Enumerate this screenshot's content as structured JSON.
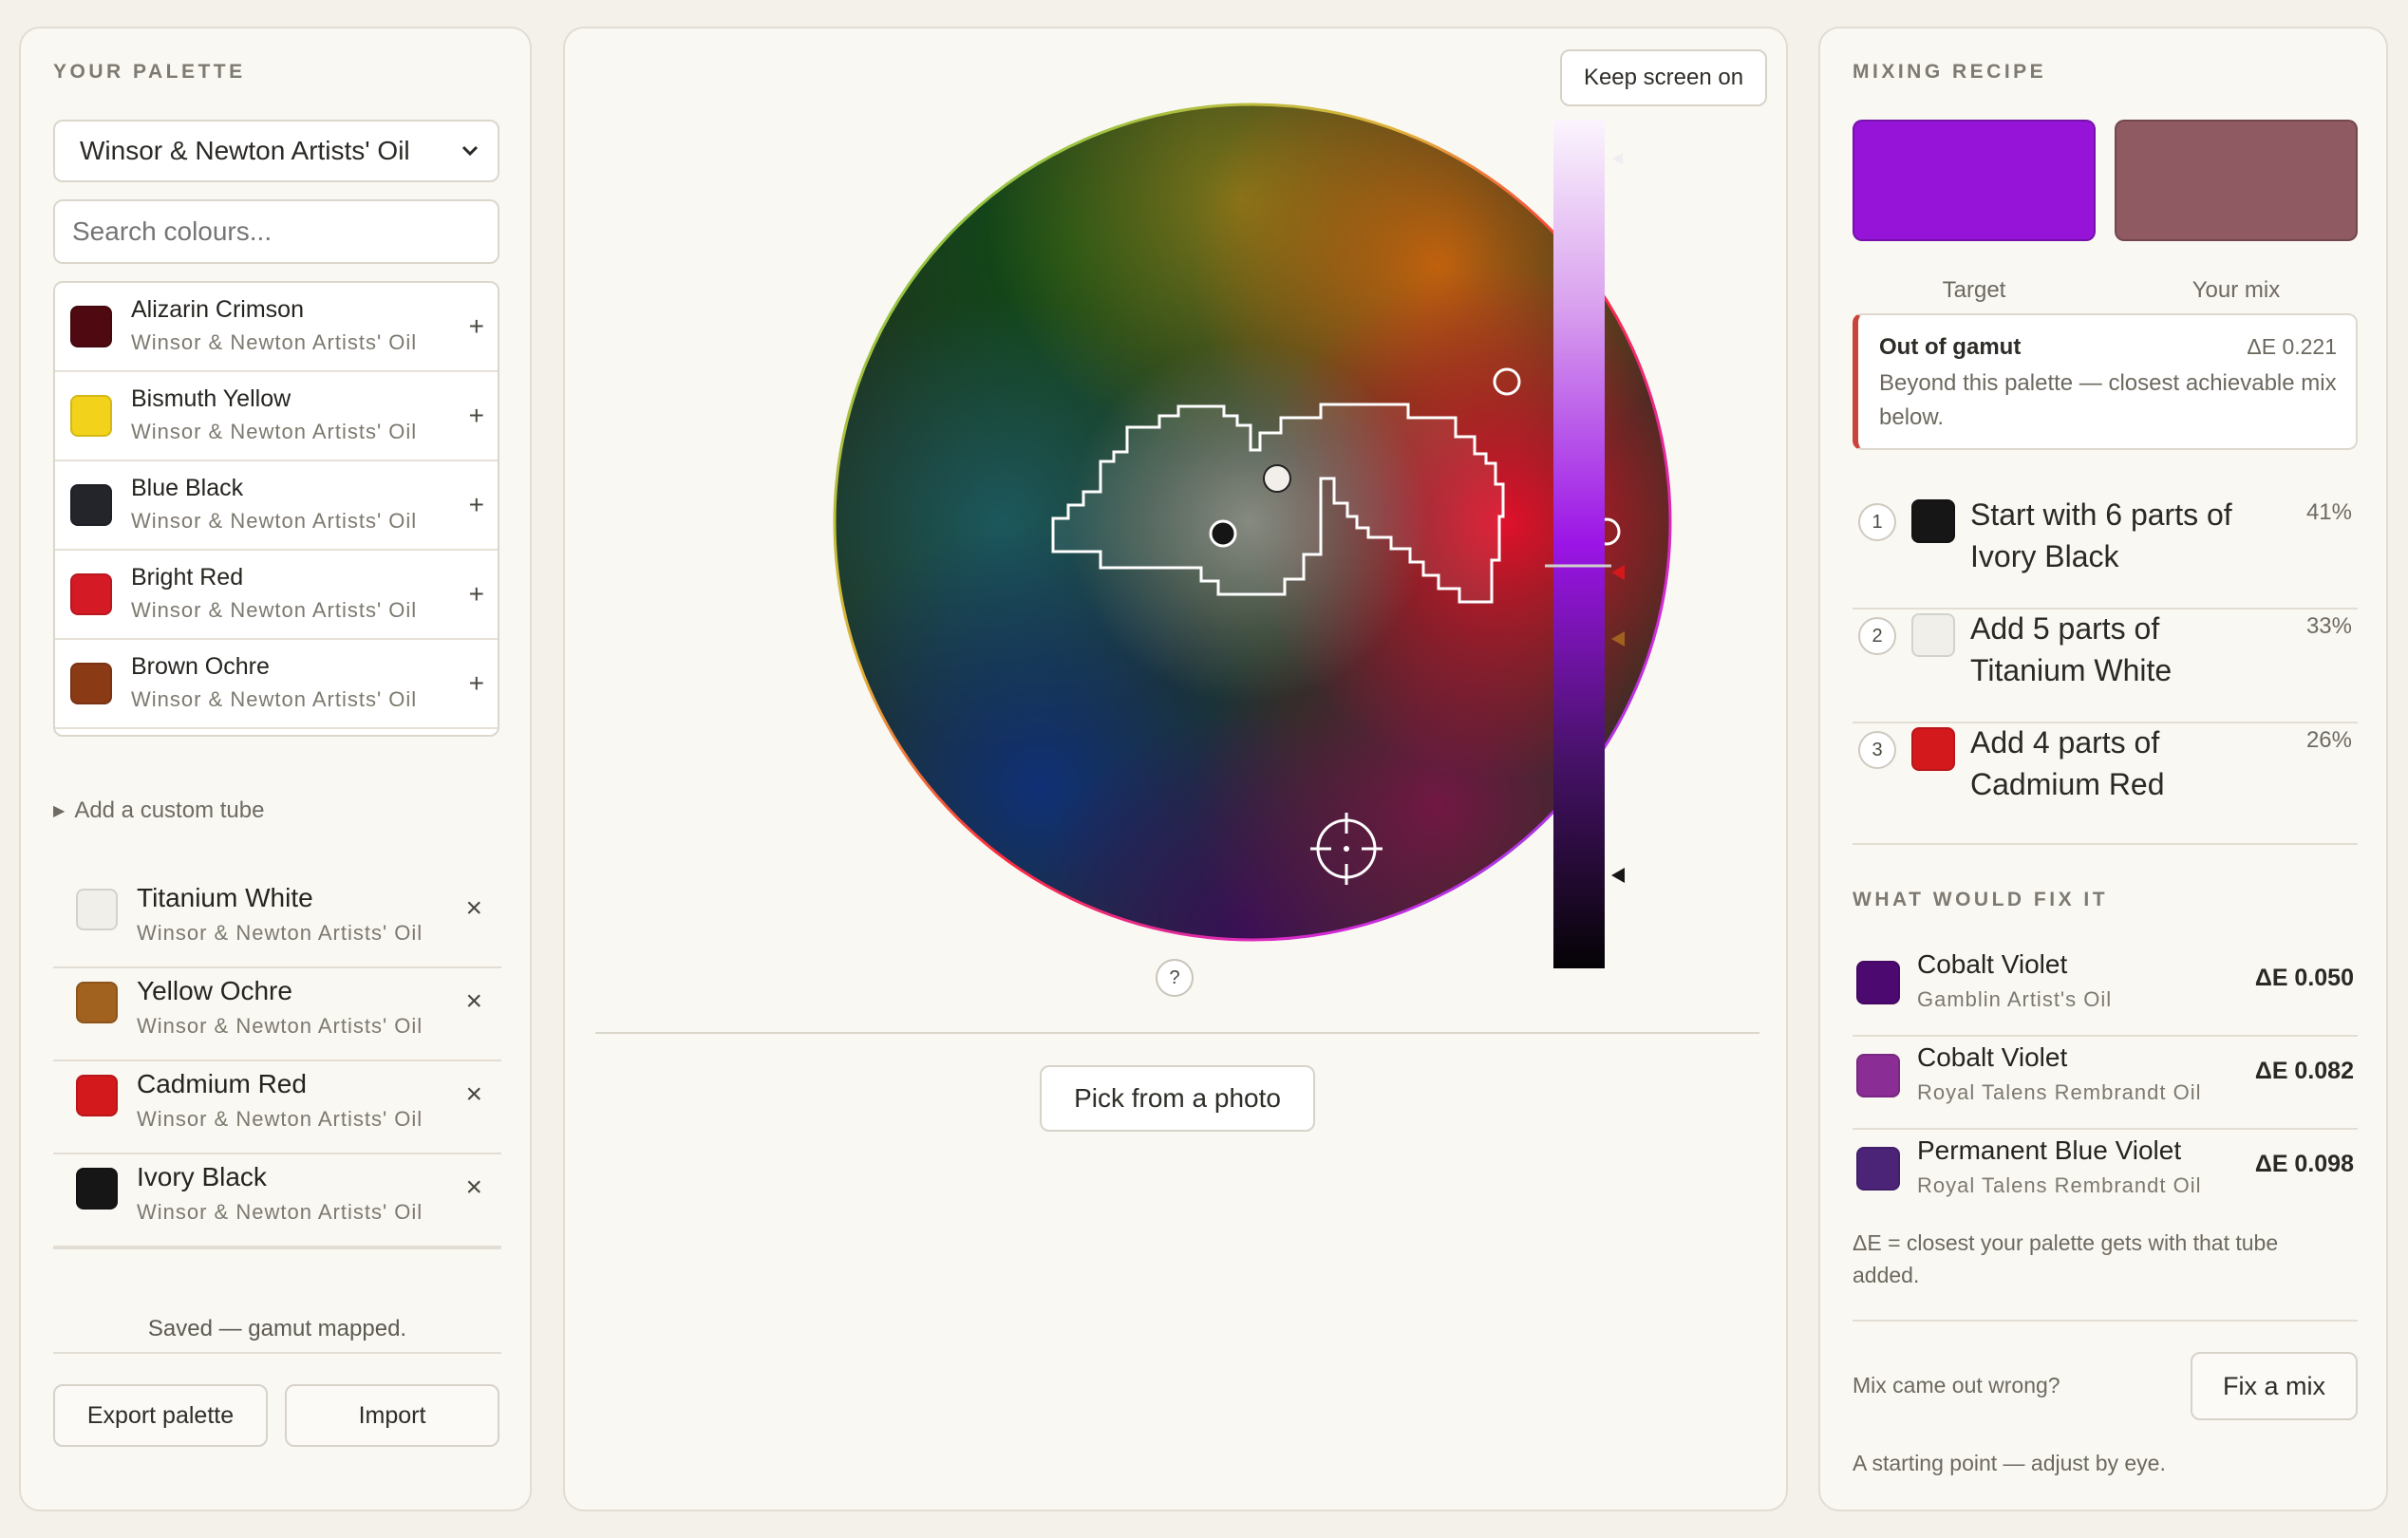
{
  "palette_panel": {
    "title": "YOUR PALETTE",
    "brand_select": "Winsor & Newton Artists' Oil",
    "search_placeholder": "Search colours...",
    "results": [
      {
        "name": "Alizarin Crimson",
        "brand": "Winsor & Newton Artists' Oil",
        "color": "#4e0a10",
        "action": "+"
      },
      {
        "name": "Bismuth Yellow",
        "brand": "Winsor & Newton Artists' Oil",
        "color": "#f2d21a",
        "action": "+"
      },
      {
        "name": "Blue Black",
        "brand": "Winsor & Newton Artists' Oil",
        "color": "#23252b",
        "action": "+"
      },
      {
        "name": "Bright Red",
        "brand": "Winsor & Newton Artists' Oil",
        "color": "#d41a24",
        "action": "+"
      },
      {
        "name": "Brown Ochre",
        "brand": "Winsor & Newton Artists' Oil",
        "color": "#8b3a16",
        "action": "+"
      }
    ],
    "custom_tube": "Add a custom tube",
    "palette": [
      {
        "name": "Titanium White",
        "brand": "Winsor & Newton Artists' Oil",
        "color": "#f1efea",
        "action": "×"
      },
      {
        "name": "Yellow Ochre",
        "brand": "Winsor & Newton Artists' Oil",
        "color": "#a1611f",
        "action": "×"
      },
      {
        "name": "Cadmium Red",
        "brand": "Winsor & Newton Artists' Oil",
        "color": "#d4191d",
        "action": "×"
      },
      {
        "name": "Ivory Black",
        "brand": "Winsor & Newton Artists' Oil",
        "color": "#161616",
        "action": "×"
      }
    ],
    "status": "Saved — gamut mapped.",
    "export_label": "Export palette",
    "import_label": "Import"
  },
  "wheel_panel": {
    "keep_screen_on": "Keep screen on",
    "help": "?",
    "pick_photo": "Pick from a photo"
  },
  "recipe_panel": {
    "title": "MIXING RECIPE",
    "target_label": "Target",
    "target_color": "#9514d8",
    "mix_label": "Your mix",
    "mix_color": "#8f5a62",
    "warning": {
      "title": "Out of gamut",
      "delta": "ΔE 0.221",
      "detail": "Beyond this palette — closest achievable mix below.",
      "accent": "#c9453b"
    },
    "steps": [
      {
        "num": "1",
        "text": "Start with 6 parts of Ivory Black",
        "pct": "41%",
        "color": "#161616"
      },
      {
        "num": "2",
        "text": "Add 5 parts of Titanium White",
        "pct": "33%",
        "color": "#f1efea"
      },
      {
        "num": "3",
        "text": "Add 4 parts of Cadmium Red",
        "pct": "26%",
        "color": "#d4191d"
      }
    ],
    "fix_title": "WHAT WOULD FIX IT",
    "fixes": [
      {
        "name": "Cobalt Violet",
        "brand": "Gamblin Artist's Oil",
        "delta": "ΔE 0.050",
        "color": "#4c0a70"
      },
      {
        "name": "Cobalt Violet",
        "brand": "Royal Talens Rembrandt Oil",
        "delta": "ΔE 0.082",
        "color": "#8a2d94"
      },
      {
        "name": "Permanent Blue Violet",
        "brand": "Royal Talens Rembrandt Oil",
        "delta": "ΔE 0.098",
        "color": "#4b2478"
      }
    ],
    "fix_note": "ΔE = closest your palette gets with that tube added.",
    "wrong_prompt": "Mix came out wrong?",
    "fix_button": "Fix a mix",
    "footer": "A starting point — adjust by eye."
  }
}
